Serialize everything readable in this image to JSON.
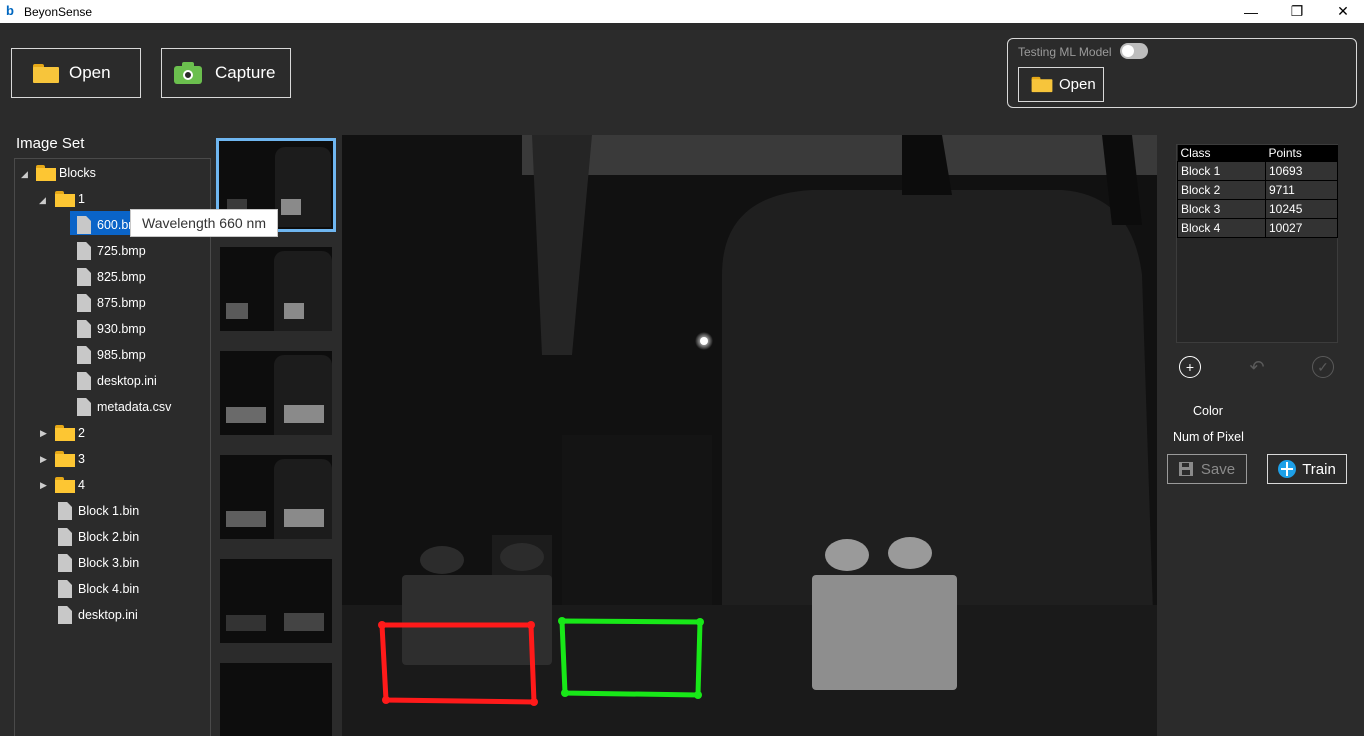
{
  "window": {
    "title": "BeyonSense",
    "logo": "b",
    "minimize": "—",
    "restore": "❐",
    "close": "✕"
  },
  "toolbar": {
    "open_label": "Open",
    "capture_label": "Capture"
  },
  "ml_panel": {
    "label": "Testing ML Model",
    "toggle_on": false,
    "open_label": "Open"
  },
  "imageset": {
    "title": "Image Set",
    "root": "Blocks",
    "folder1": "1",
    "files1": [
      "600.bmp",
      "725.bmp",
      "825.bmp",
      "875.bmp",
      "930.bmp",
      "985.bmp",
      "desktop.ini",
      "metadata.csv"
    ],
    "selected_visible": "600.br",
    "folders": [
      "2",
      "3",
      "4"
    ],
    "root_files": [
      "Block 1.bin",
      "Block 2.bin",
      "Block 3.bin",
      "Block 4.bin",
      "desktop.ini"
    ]
  },
  "tooltip": "Wavelength 660 nm",
  "stats": {
    "headers": [
      "Class",
      "Points"
    ],
    "rows": [
      [
        "Block 1",
        "10693"
      ],
      [
        "Block 2",
        "9711"
      ],
      [
        "Block 3",
        "10245"
      ],
      [
        "Block 4",
        "10027"
      ]
    ]
  },
  "controls": {
    "add_glyph": "+",
    "undo_glyph": "↶",
    "confirm_glyph": "✓",
    "color_label": "Color",
    "num_pixel_label": "Num of Pixel",
    "save_label": "Save",
    "train_label": "Train"
  },
  "colors": {
    "accent": "#0a64c8",
    "roi_red": "#ff1a1a",
    "roi_green": "#18e818",
    "thumb_border": "#6fb6f0"
  }
}
